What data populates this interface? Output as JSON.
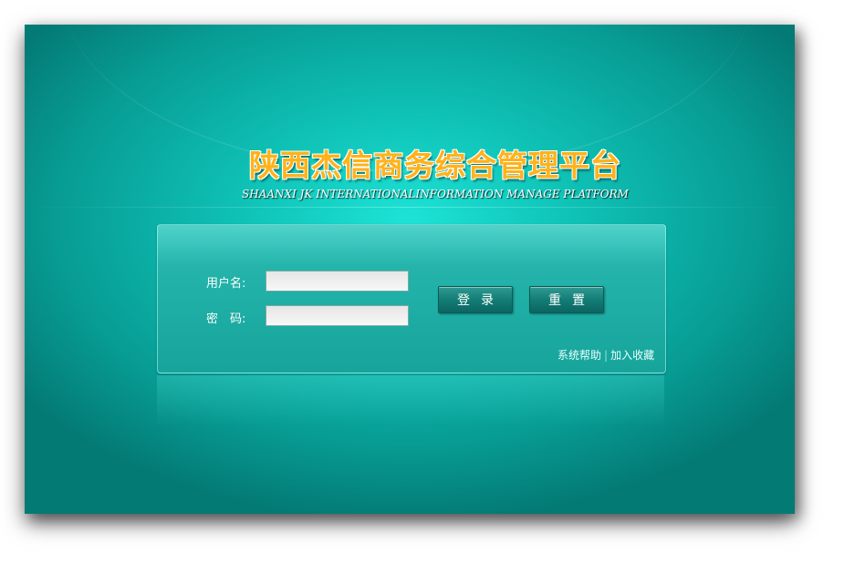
{
  "header": {
    "title": "陕西杰信商务综合管理平台",
    "subtitle": "SHAANXI JK INTERNATIONALINFORMATION MANAGE PLATFORM"
  },
  "login_form": {
    "username_label": "用户名:",
    "username_value": "",
    "password_label": "密　码:",
    "password_value": "",
    "login_button": "登录",
    "reset_button": "重置"
  },
  "footer_links": {
    "help": "系统帮助",
    "separator": "|",
    "favorite": "加入收藏"
  },
  "colors": {
    "background": "#0fc2b6",
    "title": "#ffb21a",
    "panel": "#24b4ab",
    "button": "#137d76"
  }
}
